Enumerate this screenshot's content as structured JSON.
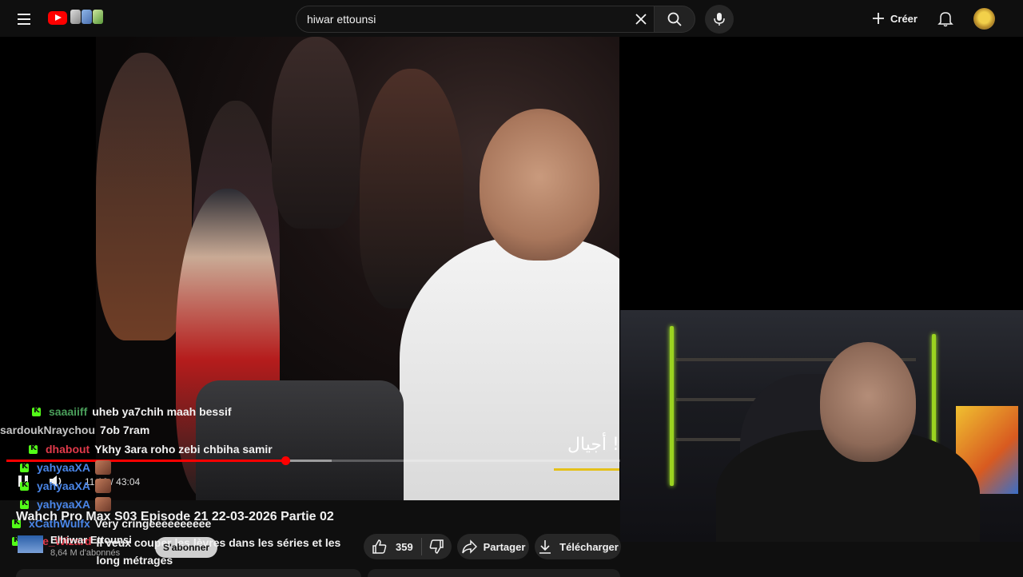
{
  "search": {
    "query": "hiwar ettounsi"
  },
  "header": {
    "create_label": "Créer"
  },
  "player": {
    "time_display": "11:10 / 43:04",
    "progress_fraction": 0.455,
    "buffer_fraction": 0.53,
    "subtitle_text": "أجيال !"
  },
  "chat": {
    "messages": [
      {
        "user": "saaaiiff",
        "user_color": "#4a9f5b",
        "text": "uheb ya7chih maah bessif",
        "badge": true
      },
      {
        "user": "sardoukNraychou",
        "user_color": "#c5c5c5",
        "text": "7ob 7ram",
        "badge": false
      },
      {
        "user": "dhabout",
        "user_color": "#e03a4a",
        "text": "Ykhy 3ara roho zebi chbiha samir",
        "badge": true
      },
      {
        "user": "yahyaaXA",
        "user_color": "#4a86e8",
        "text": "",
        "badge": true,
        "emote": true
      },
      {
        "user": "yahyaaXA",
        "user_color": "#4a86e8",
        "text": "",
        "badge": true,
        "emote": true
      },
      {
        "user": "yahyaaXA",
        "user_color": "#4a86e8",
        "text": "",
        "badge": true,
        "emote": true
      },
      {
        "user": "xCathWulfx",
        "user_color": "#4a86e8",
        "text": "Very cringeeeeeeeeee",
        "badge": true
      },
      {
        "user": "The_Wizard",
        "user_color": "#e03a4a",
        "text": "Il veux couper les lèvres dans les séries et les long métrages",
        "badge": true
      }
    ]
  },
  "video": {
    "title": "Wahch Pro Max S03 Episode 21 22-03-2026 Partie 02",
    "channel_name": "Elhiwar Ettounsi",
    "subscribers": "8,64 M d'abonnés",
    "subscribe_label": "S'abonner",
    "like_count": "359",
    "share_label": "Partager",
    "download_label": "Télécharger"
  },
  "colors": {
    "accent": "#ff0000",
    "kick_green": "#53fc18",
    "background": "#0f0f0f"
  }
}
